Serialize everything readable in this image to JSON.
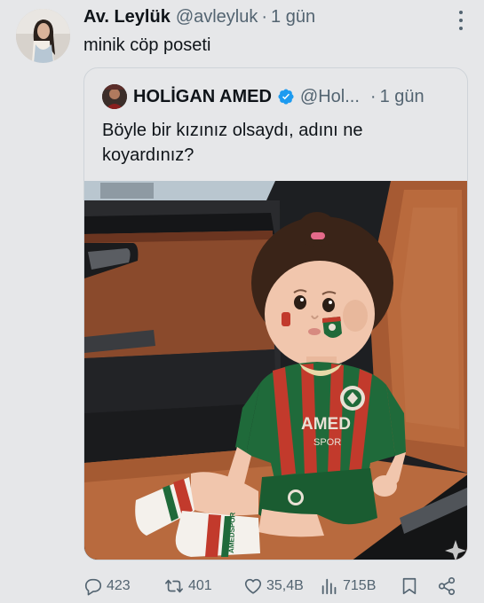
{
  "post": {
    "author_name": "Av. Leylük",
    "author_handle": "@avleyluk",
    "separator": "·",
    "time": "1 gün",
    "text": "minik cöp poseti"
  },
  "quoted": {
    "author_name": "HOLİGAN AMED",
    "author_handle": "@Hol...",
    "separator": "·",
    "time": "1 gün",
    "text_line1": "Böyle bir kızınız olsaydı, adını ne",
    "text_line2": "koyardınız?",
    "jersey_text": "AMED",
    "jersey_subtext": "SPOR",
    "sock_text": "AMEDSPOR"
  },
  "actions": {
    "replies": "423",
    "reposts": "401",
    "likes": "35,4B",
    "views": "715B"
  },
  "colors": {
    "background": "#e6e7e9",
    "text": "#0f1419",
    "secondary_text": "#536471",
    "verified": "#1d9bf0",
    "jersey_green": "#1f6a3a",
    "jersey_red": "#c23a2c"
  },
  "icons": [
    "more-icon",
    "verified-icon",
    "reply-icon",
    "repost-icon",
    "like-icon",
    "views-icon",
    "bookmark-icon",
    "share-icon"
  ]
}
